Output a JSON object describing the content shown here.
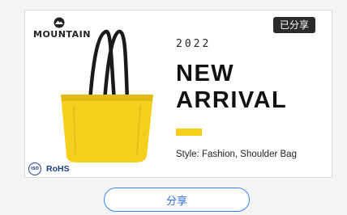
{
  "badge": {
    "label": "已分享"
  },
  "brand": {
    "name": "MOUNTAIN",
    "icon": "mountain-logo-icon"
  },
  "product": {
    "image": "yellow-tote-bag",
    "color": "#f5cf1c"
  },
  "promo": {
    "year": "2022",
    "headline_line1": "NEW",
    "headline_line2": "ARRIVAL",
    "style_label": "Style:",
    "style_value": "Fashion, Shoulder Bag"
  },
  "certifications": {
    "iso": "ISO",
    "rohs": "RoHS"
  },
  "share_button": {
    "label": "分享",
    "color": "#3b82f6"
  }
}
